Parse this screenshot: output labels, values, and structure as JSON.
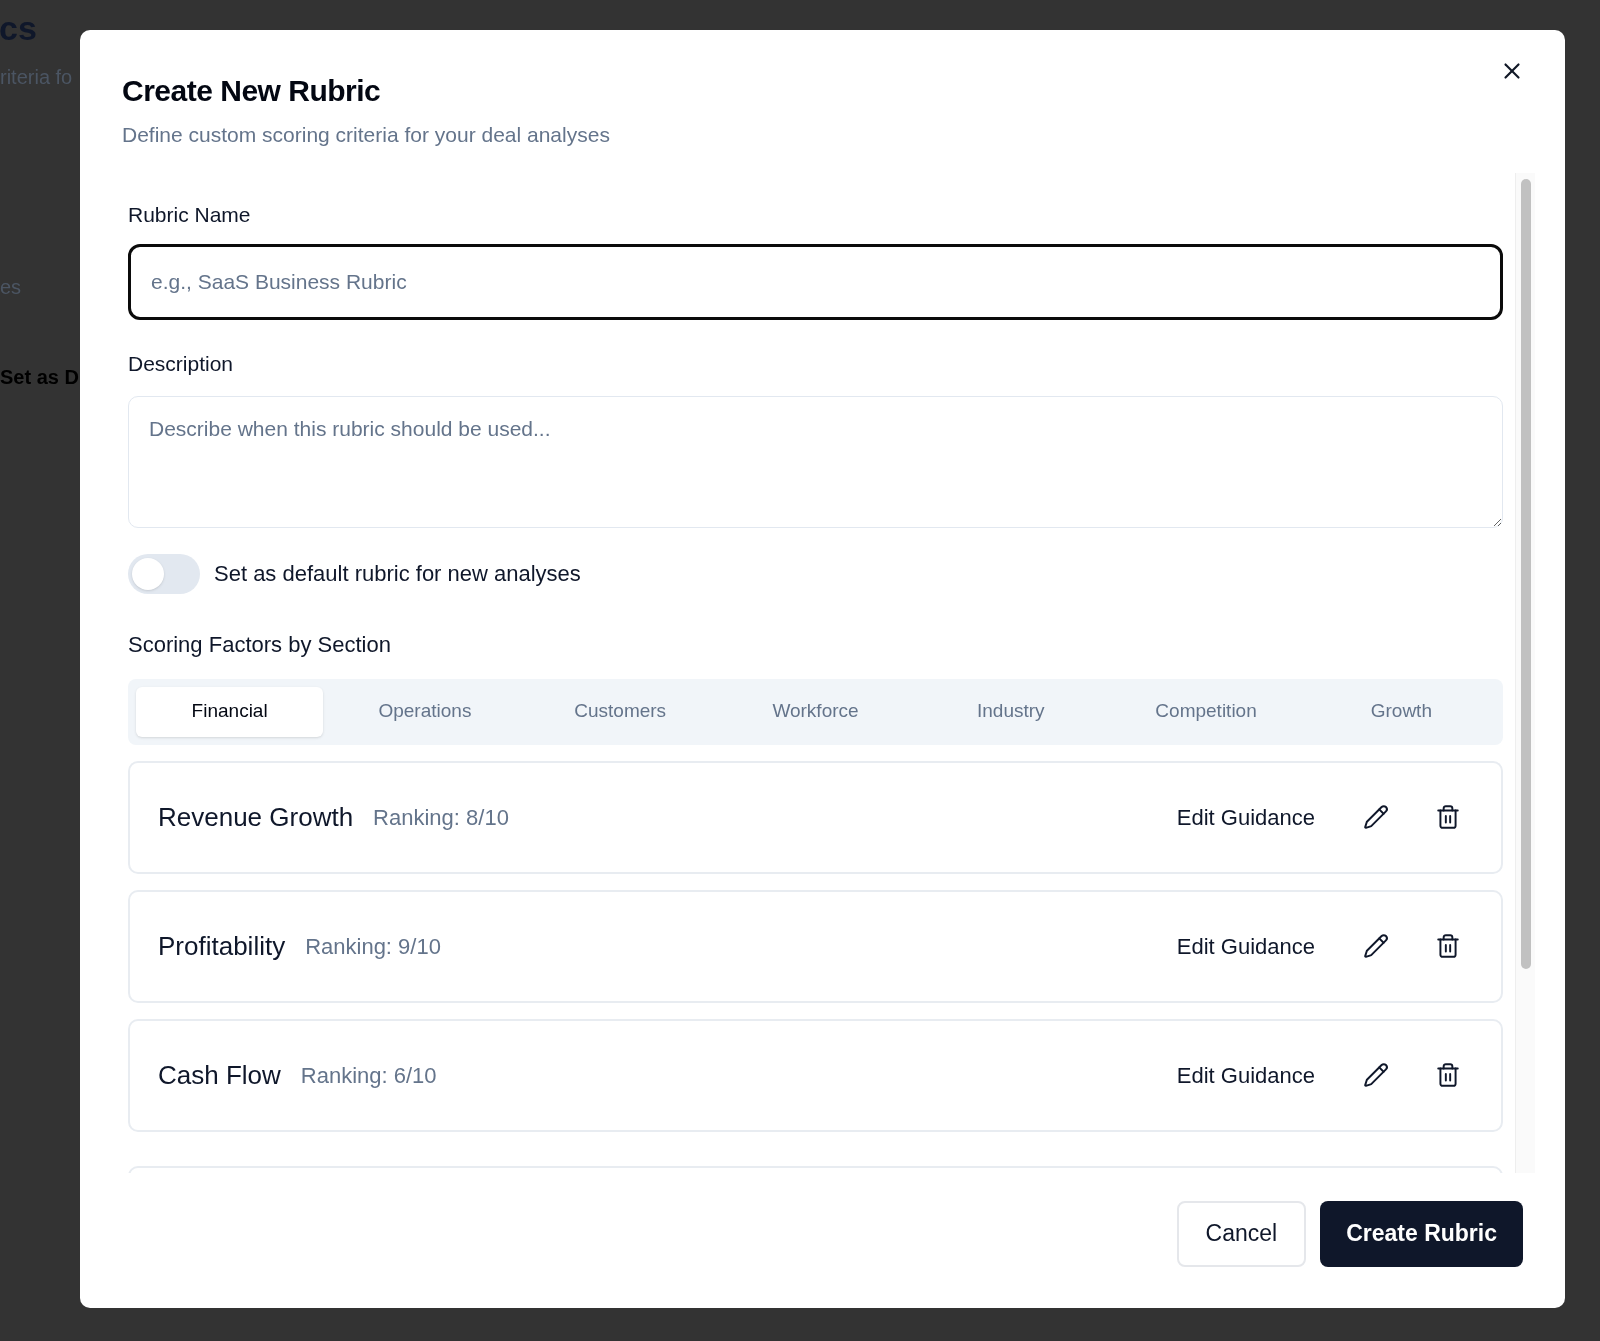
{
  "background_page": {
    "title": "cs",
    "subtitle": "riteria fo",
    "link": "es",
    "button": "Set as D"
  },
  "dialog": {
    "title": "Create New Rubric",
    "subtitle": "Define custom scoring criteria for your deal analyses",
    "name_field": {
      "label": "Rubric Name",
      "placeholder": "e.g., SaaS Business Rubric",
      "focused": true
    },
    "description_field": {
      "label": "Description",
      "placeholder": "Describe when this rubric should be used..."
    },
    "default_toggle": {
      "label": "Set as default rubric for new analyses",
      "on": false
    },
    "section_heading": "Scoring Factors by Section",
    "tabs": [
      {
        "label": "Financial",
        "selected": true
      },
      {
        "label": "Operations",
        "selected": false
      },
      {
        "label": "Customers",
        "selected": false
      },
      {
        "label": "Workforce",
        "selected": false
      },
      {
        "label": "Industry",
        "selected": false
      },
      {
        "label": "Competition",
        "selected": false
      },
      {
        "label": "Growth",
        "selected": false
      }
    ],
    "factors": [
      {
        "name": "Revenue Growth",
        "ranking": "Ranking: 8/10",
        "action": "Edit Guidance"
      },
      {
        "name": "Profitability",
        "ranking": "Ranking: 9/10",
        "action": "Edit Guidance"
      },
      {
        "name": "Cash Flow",
        "ranking": "Ranking: 6/10",
        "action": "Edit Guidance"
      }
    ],
    "buttons": {
      "cancel": "Cancel",
      "submit": "Create Rubric"
    }
  }
}
